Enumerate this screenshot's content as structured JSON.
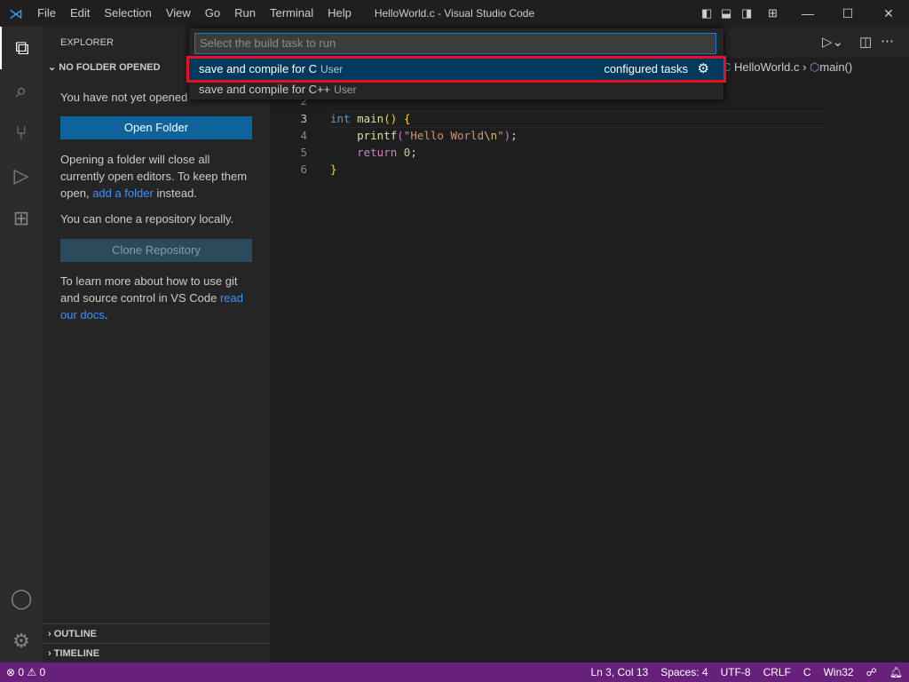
{
  "titlebar": {
    "title": "HelloWorld.c - Visual Studio Code",
    "menu": [
      "File",
      "Edit",
      "Selection",
      "View",
      "Go",
      "Run",
      "Terminal",
      "Help"
    ]
  },
  "sidebar": {
    "header": "EXPLORER",
    "section": "NO FOLDER OPENED",
    "msg1": "You have not yet opened a folder.",
    "open_folder": "Open Folder",
    "msg2a": "Opening a folder will close all currently open editors. To keep them open, ",
    "msg2link": "add a folder",
    "msg2b": " instead.",
    "msg3": "You can clone a repository locally.",
    "clone": "Clone Repository",
    "msg4a": "To learn more about how to use git and source control in VS Code ",
    "msg4link": "read our docs",
    "msg4b": ".",
    "outline": "OUTLINE",
    "timeline": "TIMELINE"
  },
  "breadcrumb": {
    "file": "HelloWorld.c",
    "symbol": "main()"
  },
  "editor": {
    "lines": [
      {
        "n": "2",
        "t": ""
      },
      {
        "n": "3",
        "t": "int main() {"
      },
      {
        "n": "4",
        "t": "    printf(\"Hello World\\n\");"
      },
      {
        "n": "5",
        "t": "    return 0;"
      },
      {
        "n": "6",
        "t": "}"
      }
    ]
  },
  "quickpick": {
    "placeholder": "Select the build task to run",
    "items": [
      {
        "label": "save and compile for C",
        "desc": "User",
        "right": "configured tasks"
      },
      {
        "label": "save and compile for C++",
        "desc": "User"
      }
    ]
  },
  "status": {
    "errors": "0",
    "warnings": "0",
    "position": "Ln 3, Col 13",
    "spaces": "Spaces: 4",
    "encoding": "UTF-8",
    "eol": "CRLF",
    "language": "C",
    "platform": "Win32"
  },
  "colors": {
    "statusbar": "#68217a",
    "selection": "#04395e",
    "highlight": "#e81123",
    "button": "#0e639c"
  }
}
